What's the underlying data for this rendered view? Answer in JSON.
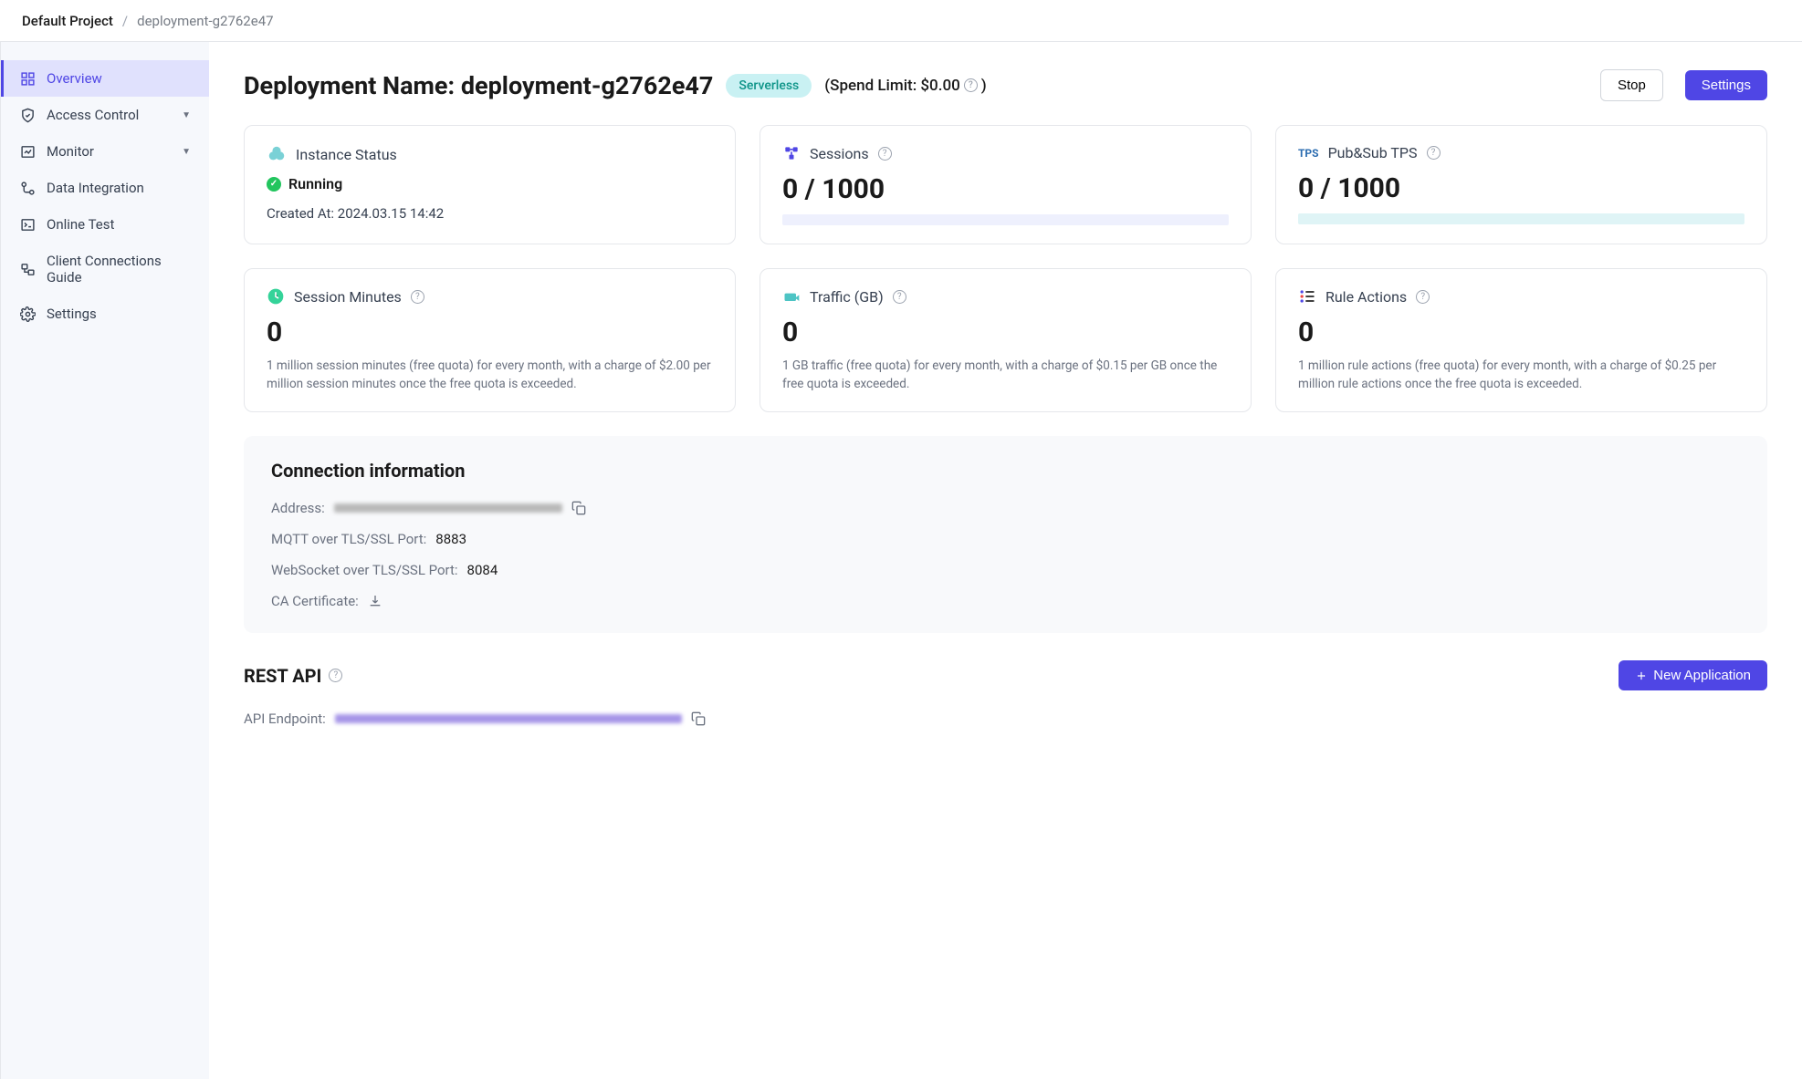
{
  "breadcrumb": {
    "project": "Default Project",
    "current": "deployment-g2762e47"
  },
  "sidebar": {
    "items": [
      {
        "label": "Overview"
      },
      {
        "label": "Access Control"
      },
      {
        "label": "Monitor"
      },
      {
        "label": "Data Integration"
      },
      {
        "label": "Online Test"
      },
      {
        "label": "Client Connections Guide"
      },
      {
        "label": "Settings"
      }
    ]
  },
  "header": {
    "title": "Deployment Name: deployment-g2762e47",
    "badge": "Serverless",
    "spend_limit": "(Spend Limit: $0.00",
    "spend_close": ")",
    "stop": "Stop",
    "settings": "Settings"
  },
  "cards": {
    "instance": {
      "title": "Instance Status",
      "status": "Running",
      "created_label": "Created At:",
      "created_value": "2024.03.15 14:42"
    },
    "sessions": {
      "title": "Sessions",
      "value": "0 / 1000"
    },
    "tps": {
      "title_prefix": "TPS",
      "title": "Pub&Sub TPS",
      "value": "0 / 1000"
    },
    "minutes": {
      "title": "Session Minutes",
      "value": "0",
      "desc": "1 million session minutes (free quota) for every month, with a charge of $2.00 per million session minutes once the free quota is exceeded."
    },
    "traffic": {
      "title": "Traffic (GB)",
      "value": "0",
      "desc": "1 GB traffic (free quota) for every month, with a charge of $0.15 per GB once the free quota is exceeded."
    },
    "rules": {
      "title": "Rule Actions",
      "value": "0",
      "desc": "1 million rule actions (free quota) for every month, with a charge of $0.25 per million rule actions once the free quota is exceeded."
    }
  },
  "connection": {
    "heading": "Connection information",
    "address_label": "Address:",
    "mqtt_label": "MQTT over TLS/SSL Port:",
    "mqtt_port": "8883",
    "ws_label": "WebSocket over TLS/SSL Port:",
    "ws_port": "8084",
    "ca_label": "CA Certificate:"
  },
  "rest": {
    "heading": "REST API",
    "new_app": "New Application",
    "endpoint_label": "API Endpoint:"
  }
}
